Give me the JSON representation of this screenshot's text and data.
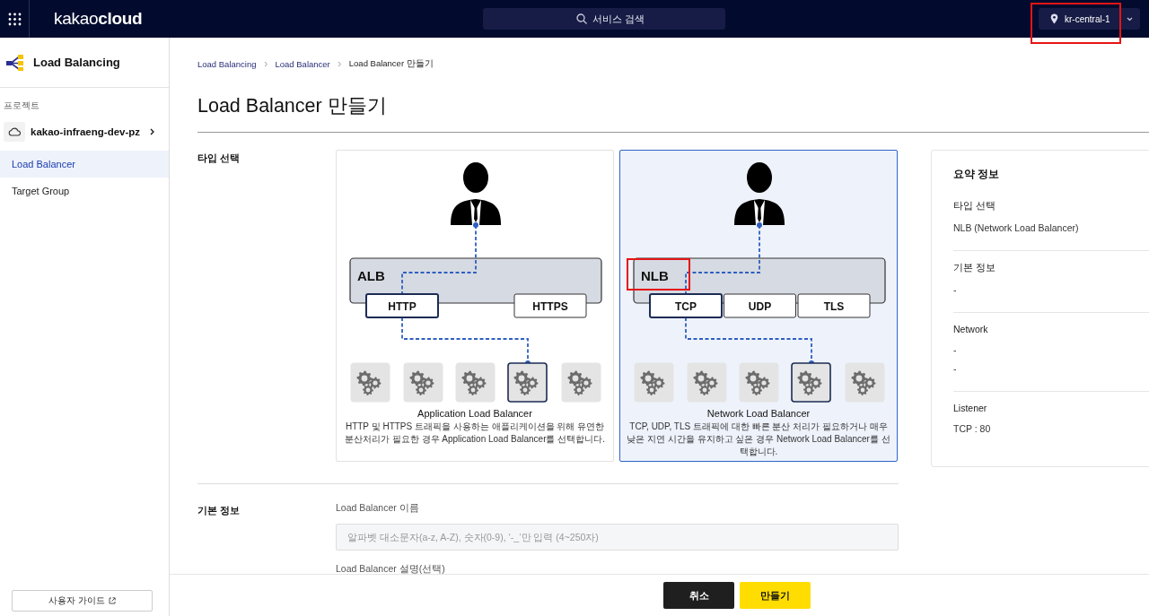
{
  "topbar": {
    "logo": "kakao**cloud**",
    "search": {
      "placeholder": "서비스 검색"
    },
    "region": "kr-central-1"
  },
  "sidebar": {
    "service": "Load Balancing",
    "project_label": "프로젝트",
    "project": "kakao-infraeng-dev-pz",
    "items": [
      {
        "label": "Load Balancer",
        "selected": true
      },
      {
        "label": "Target Group",
        "selected": false
      }
    ],
    "guide": "사용자 가이드"
  },
  "breadcrumb": [
    "Load Balancing",
    "Load Balancer",
    "Load Balancer 만들기"
  ],
  "title": "Load Balancer 만들기",
  "type_section": {
    "label": "타입 선택",
    "options": [
      {
        "badge": "ALB",
        "selected": false,
        "listeners": [
          {
            "label": "HTTP",
            "selected": true
          },
          {
            "label": "HTTPS",
            "selected": false
          }
        ],
        "title": "Application Load Balancer",
        "description": "HTTP 및 HTTPS 트래픽을 사용하는 애플리케이션을 위해 유연한 분산처리가 필요한 경우 Application Load Balancer를 선택합니다."
      },
      {
        "badge": "NLB",
        "selected": true,
        "listeners": [
          {
            "label": "TCP",
            "selected": true
          },
          {
            "label": "UDP",
            "selected": false
          },
          {
            "label": "TLS",
            "selected": false
          }
        ],
        "title": "Network Load Balancer",
        "description": "TCP, UDP, TLS 트래픽에 대한 빠른 분산 처리가 필요하거나 매우 낮은 지연 시간을 유지하고 싶은 경우 Network Load Balancer를 선택합니다."
      }
    ]
  },
  "basic_section": {
    "label": "기본 정보",
    "fields": [
      {
        "label": "Load Balancer 이름",
        "placeholder": "알파벳 대소문자(a-z, A-Z), 숫자(0-9), ‘-_’만 입력 (4~250자)"
      }
    ],
    "next_label": "Load Balancer 설명(선택)"
  },
  "summary": {
    "title": "요약 정보",
    "sections": [
      {
        "label": "타입 선택",
        "values": [
          "NLB (Network Load Balancer)"
        ]
      },
      {
        "label": "기본 정보",
        "values": [
          "-"
        ]
      },
      {
        "label": "Network",
        "values": [
          "-",
          "-"
        ]
      },
      {
        "label": "Listener",
        "values": [
          "TCP : 80"
        ]
      }
    ]
  },
  "footer": {
    "buttons": [
      {
        "label": "취소",
        "kind": "secondary"
      },
      {
        "label": "만들기",
        "kind": "primary"
      }
    ]
  }
}
